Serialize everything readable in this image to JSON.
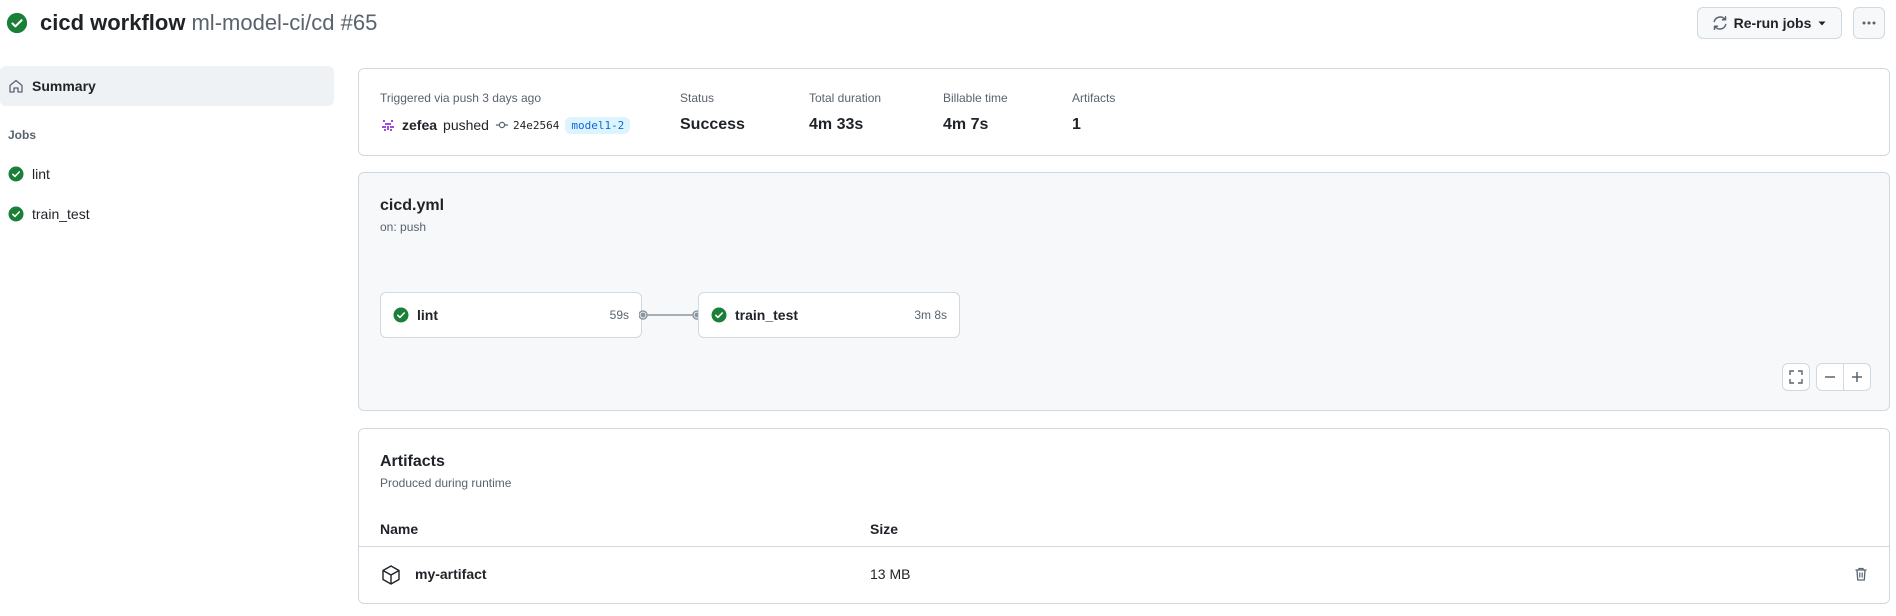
{
  "header": {
    "workflow_name": "cicd workflow",
    "repo_run": "ml-model-ci/cd #65",
    "rerun_label": "Re-run jobs",
    "status_color": "#1a7f37"
  },
  "sidebar": {
    "summary_label": "Summary",
    "jobs_heading": "Jobs",
    "jobs": [
      {
        "label": "lint",
        "status": "success"
      },
      {
        "label": "train_test",
        "status": "success"
      }
    ]
  },
  "summary": {
    "trigger_text": "Triggered via push 3 days ago",
    "user": "zefea",
    "action": "pushed",
    "commit": "24e2564",
    "branch": "model1-2",
    "status_label": "Status",
    "status_value": "Success",
    "duration_label": "Total duration",
    "duration_value": "4m 33s",
    "billable_label": "Billable time",
    "billable_value": "4m 7s",
    "artifacts_label": "Artifacts",
    "artifacts_value": "1"
  },
  "graph": {
    "file": "cicd.yml",
    "trigger": "on: push",
    "jobs": [
      {
        "name": "lint",
        "duration": "59s"
      },
      {
        "name": "train_test",
        "duration": "3m 8s"
      }
    ]
  },
  "artifacts": {
    "title": "Artifacts",
    "subtitle": "Produced during runtime",
    "col_name": "Name",
    "col_size": "Size",
    "rows": [
      {
        "name": "my-artifact",
        "size": "13 MB"
      }
    ]
  },
  "colors": {
    "success": "#1a7f37",
    "accent": "#0969da",
    "branch_bg": "#ddf4ff",
    "border": "#d1d9e0",
    "muted": "#59636e"
  },
  "icons": [
    "check-circle-icon",
    "home-icon",
    "sync-icon",
    "triangle-down-icon",
    "kebab-horizontal-icon",
    "git-commit-icon",
    "package-icon",
    "trash-icon",
    "screen-full-icon",
    "dash-icon",
    "plus-icon"
  ]
}
